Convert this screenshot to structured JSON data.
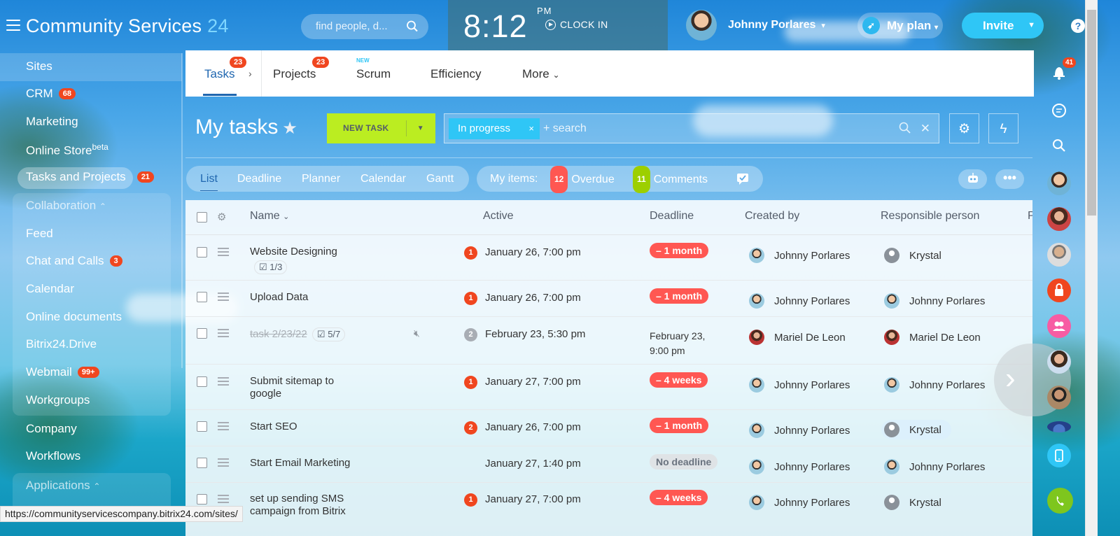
{
  "header": {
    "title": "Community Services",
    "title_suffix": "24",
    "search_placeholder": "find people, d...",
    "clock_time": "8:12",
    "clock_meridiem": "PM",
    "clock_in_label": "CLOCK IN",
    "user_name": "Johnny Porlares",
    "my_plan_label": "My plan",
    "invite_label": "Invite",
    "help_label": "?"
  },
  "left_menu": {
    "sites": "Sites",
    "crm": "CRM",
    "crm_badge": "68",
    "marketing": "Marketing",
    "online_store": "Online Store",
    "online_store_sup": "beta",
    "tasks_projects": "Tasks and Projects",
    "tasks_projects_badge": "21",
    "collaboration": "Collaboration",
    "feed": "Feed",
    "chat_calls": "Chat and Calls",
    "chat_calls_badge": "3",
    "calendar": "Calendar",
    "online_documents": "Online documents",
    "drive": "Bitrix24.Drive",
    "webmail": "Webmail",
    "webmail_badge": "99+",
    "workgroups": "Workgroups",
    "company": "Company",
    "workflows": "Workflows",
    "applications": "Applications"
  },
  "top_nav": {
    "tasks": "Tasks",
    "tasks_badge": "23",
    "projects": "Projects",
    "projects_badge": "23",
    "scrum": "Scrum",
    "scrum_new": "NEW",
    "efficiency": "Efficiency",
    "more": "More"
  },
  "toolbar": {
    "page_title": "My tasks",
    "new_task": "NEW TASK",
    "filter_chip": "In progress",
    "search_placeholder": "+ search"
  },
  "views": {
    "list": "List",
    "deadline": "Deadline",
    "planner": "Planner",
    "calendar": "Calendar",
    "gantt": "Gantt"
  },
  "my_items": {
    "label": "My items:",
    "overdue_count": "12",
    "overdue_label": "Overdue",
    "comments_count": "11",
    "comments_label": "Comments"
  },
  "table": {
    "columns": {
      "name": "Name",
      "active": "Active",
      "deadline": "Deadline",
      "created_by": "Created by",
      "responsible": "Responsible person",
      "extra": "P"
    },
    "rows": [
      {
        "name": "Website Designing",
        "subtasks": "1/3",
        "counter": "1",
        "active": "January 26, 7:00 pm",
        "deadline": "– 1 month",
        "created_by": "Johnny Porlares",
        "responsible": "Krystal"
      },
      {
        "name": "Upload Data",
        "counter": "1",
        "active": "January 26, 7:00 pm",
        "deadline": "– 1 month",
        "created_by": "Johnny Porlares",
        "responsible": "Johnny Porlares"
      },
      {
        "name": "task 2/23/22",
        "subtasks": "5/7",
        "counter": "2",
        "active": "February 23, 5:30 pm",
        "deadline_line1": "February 23,",
        "deadline_line2": "9:00 pm",
        "created_by": "Mariel De Leon",
        "responsible": "Mariel De Leon"
      },
      {
        "name_line1": "Submit sitemap to",
        "name_line2": "google",
        "counter": "1",
        "active": "January 27, 7:00 pm",
        "deadline": "– 4 weeks",
        "created_by": "Johnny Porlares",
        "responsible": "Johnny Porlares"
      },
      {
        "name": "Start SEO",
        "counter": "2",
        "active": "January 26, 7:00 pm",
        "deadline": "– 1 month",
        "created_by": "Johnny Porlares",
        "responsible": "Krystal"
      },
      {
        "name": "Start Email Marketing",
        "active": "January 27, 1:40 pm",
        "deadline": "No deadline",
        "created_by": "Johnny Porlares",
        "responsible": "Johnny Porlares"
      },
      {
        "name_line1": "set up sending SMS",
        "name_line2": "campaign from Bitrix",
        "counter": "1",
        "active": "January 27, 7:00 pm",
        "deadline": "– 4 weeks",
        "created_by": "Johnny Porlares",
        "responsible": "Krystal"
      }
    ]
  },
  "right_bar": {
    "notifications_badge": "41"
  },
  "status_bar": {
    "url": "https://communityservicescompany.bitrix24.com/sites/"
  },
  "colors": {
    "accent": "#2fc6f6",
    "new_task": "#bbed21",
    "overdue_badge": "#ff5752",
    "counter_red": "#f0461f",
    "comments_green": "#9dcf00"
  }
}
